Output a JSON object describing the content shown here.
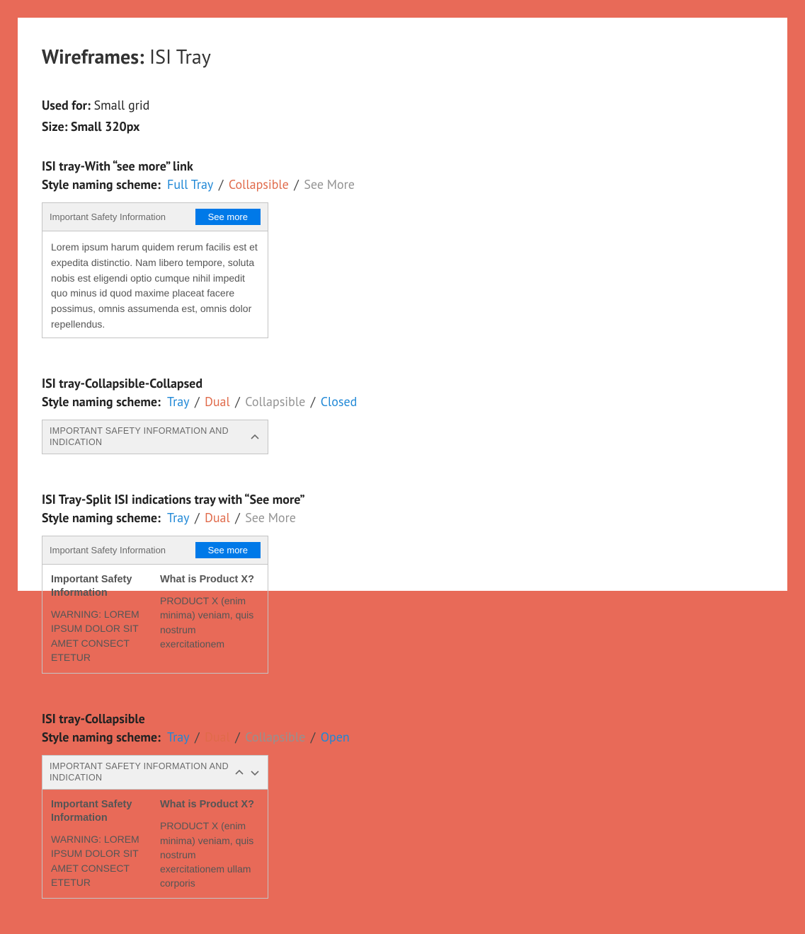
{
  "title_prefix": "Wireframes:",
  "title_suffix": "ISI Tray",
  "used_for_label": "Used for:",
  "used_for_value": "Small grid",
  "size_label": "Size: Small 320px",
  "scheme_label": "Style naming scheme:",
  "sep": "/",
  "tray_a": {
    "title": "ISI tray-With “see more” link",
    "scheme": {
      "p1": "Full Tray",
      "p2": "Collapsible",
      "p3": "See More"
    },
    "header": "Important Safety Information",
    "see_more": "See more",
    "body": "Lorem ipsum harum quidem rerum facilis est et expedita distinctio. Nam libero tempore, soluta nobis est eligendi optio cumque nihil impedit quo minus id quod maxime placeat facere possimus, omnis assumenda est, omnis dolor repellendus."
  },
  "tray_b": {
    "title": "ISI tray-Collapsible-Collapsed",
    "scheme": {
      "p1": "Tray",
      "p2": "Dual",
      "p3": "Collapsible",
      "p4": "Closed"
    },
    "header": "IMPORTANT SAFETY INFORMATION AND INDICATION"
  },
  "tray_c": {
    "title": "ISI Tray-Split ISI indications tray with “See more”",
    "scheme": {
      "p1": "Tray",
      "p2": "Dual",
      "p3": "See More"
    },
    "header": "Important Safety Information",
    "see_more": "See more",
    "col1_h": "Important Safety Information",
    "col1_p": "WARNING: LOREM IPSUM DOLOR SIT AMET CONSECT ETETUR",
    "col2_h": "What is Product X?",
    "col2_p": "PRODUCT X (enim minima) veniam, quis nostrum exercitationem"
  },
  "tray_d": {
    "title": "ISI tray-Collapsible",
    "scheme": {
      "p1": "Tray",
      "p2": "Dual",
      "p3": "Collapsible",
      "p4": "Open"
    },
    "header": "IMPORTANT SAFETY INFORMATION AND INDICATION",
    "col1_h": "Important Safety Information",
    "col1_p": "WARNING: LOREM IPSUM DOLOR SIT AMET CONSECT ETETUR",
    "col2_h": "What is Product X?",
    "col2_p": "PRODUCT X (enim minima) veniam, quis nostrum exercitationem ullam corporis"
  }
}
